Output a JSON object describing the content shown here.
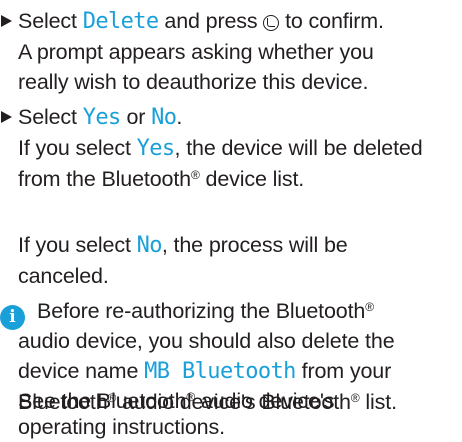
{
  "steps": [
    {
      "lines": [
        {
          "pre": "Select ",
          "kw": "Delete",
          "post": " and press ",
          "knob": true,
          "tail": " to confirm."
        },
        {
          "text": "A prompt appears asking whether you"
        },
        {
          "text": "really wish to deauthorize this device."
        }
      ]
    },
    {
      "lines": [
        {
          "pre": "Select ",
          "kw": "Yes",
          "mid": " or ",
          "kw2": "No",
          "post": "."
        },
        {
          "pre": "If you select ",
          "kw": "Yes",
          "post": ", the device will be deleted"
        },
        {
          "text": "from the Bluetooth",
          "sup": "®",
          "after": " device list."
        }
      ]
    }
  ],
  "note_no": {
    "lines": [
      {
        "pre": "If you select ",
        "kw": "No",
        "post": ", the process will be"
      },
      {
        "text": "canceled."
      }
    ]
  },
  "info": {
    "icon": "info-icon",
    "line1": "Before re-authorizing the Bluetooth",
    "line2": "audio device, you should also delete the",
    "line3_pre": "device name ",
    "line3_kw": "MB Bluetooth",
    "line3_post": " from your",
    "line4_a": "Bluetooth",
    "line4_b": " audio device's Bluetooth",
    "line4_c": " list.",
    "line5_a": "See the Bluetooth",
    "line5_b": " audio device's",
    "line6": "operating instructions.",
    "reg": "®"
  },
  "colors": {
    "accent": "#1aa0d9",
    "text": "#231f20"
  }
}
